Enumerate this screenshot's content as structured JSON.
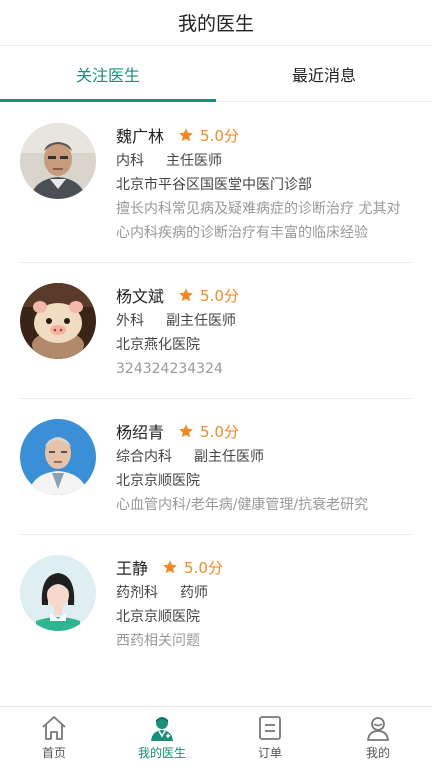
{
  "header": {
    "title": "我的医生"
  },
  "tabs": [
    {
      "label": "关注医生",
      "active": true
    },
    {
      "label": "最近消息",
      "active": false
    }
  ],
  "doctors": [
    {
      "name": "魏广林",
      "rating": "5.0分",
      "department": "内科",
      "title": "主任医师",
      "hospital": "北京市平谷区国医堂中医门诊部",
      "description": "擅长内科常见病及疑难病症的诊断治疗 尤其对心内科疾病的诊断治疗有丰富的临床经验",
      "avatar": "photo-older-man"
    },
    {
      "name": "杨文斌",
      "rating": "5.0分",
      "department": "外科",
      "title": "副主任医师",
      "hospital": "北京燕化医院",
      "description": "324324234324",
      "avatar": "cartoon-pig-toy"
    },
    {
      "name": "杨绍青",
      "rating": "5.0分",
      "department": "综合内科",
      "title": "副主任医师",
      "hospital": "北京京顺医院",
      "description": "心血管内科/老年病/健康管理/抗衰老研究",
      "avatar": "photo-doctor-white-coat"
    },
    {
      "name": "王静",
      "rating": "5.0分",
      "department": "药剂科",
      "title": "药师",
      "hospital": "北京京顺医院",
      "description": "西药相关问题",
      "avatar": "female-placeholder"
    }
  ],
  "bottom_nav": [
    {
      "label": "首页",
      "icon": "home-icon",
      "active": false
    },
    {
      "label": "我的医生",
      "icon": "doctor-icon",
      "active": true
    },
    {
      "label": "订单",
      "icon": "order-icon",
      "active": false
    },
    {
      "label": "我的",
      "icon": "profile-icon",
      "active": false
    }
  ],
  "colors": {
    "accent": "#1a8f7a",
    "rating": "#f08a24",
    "muted": "#999999"
  }
}
